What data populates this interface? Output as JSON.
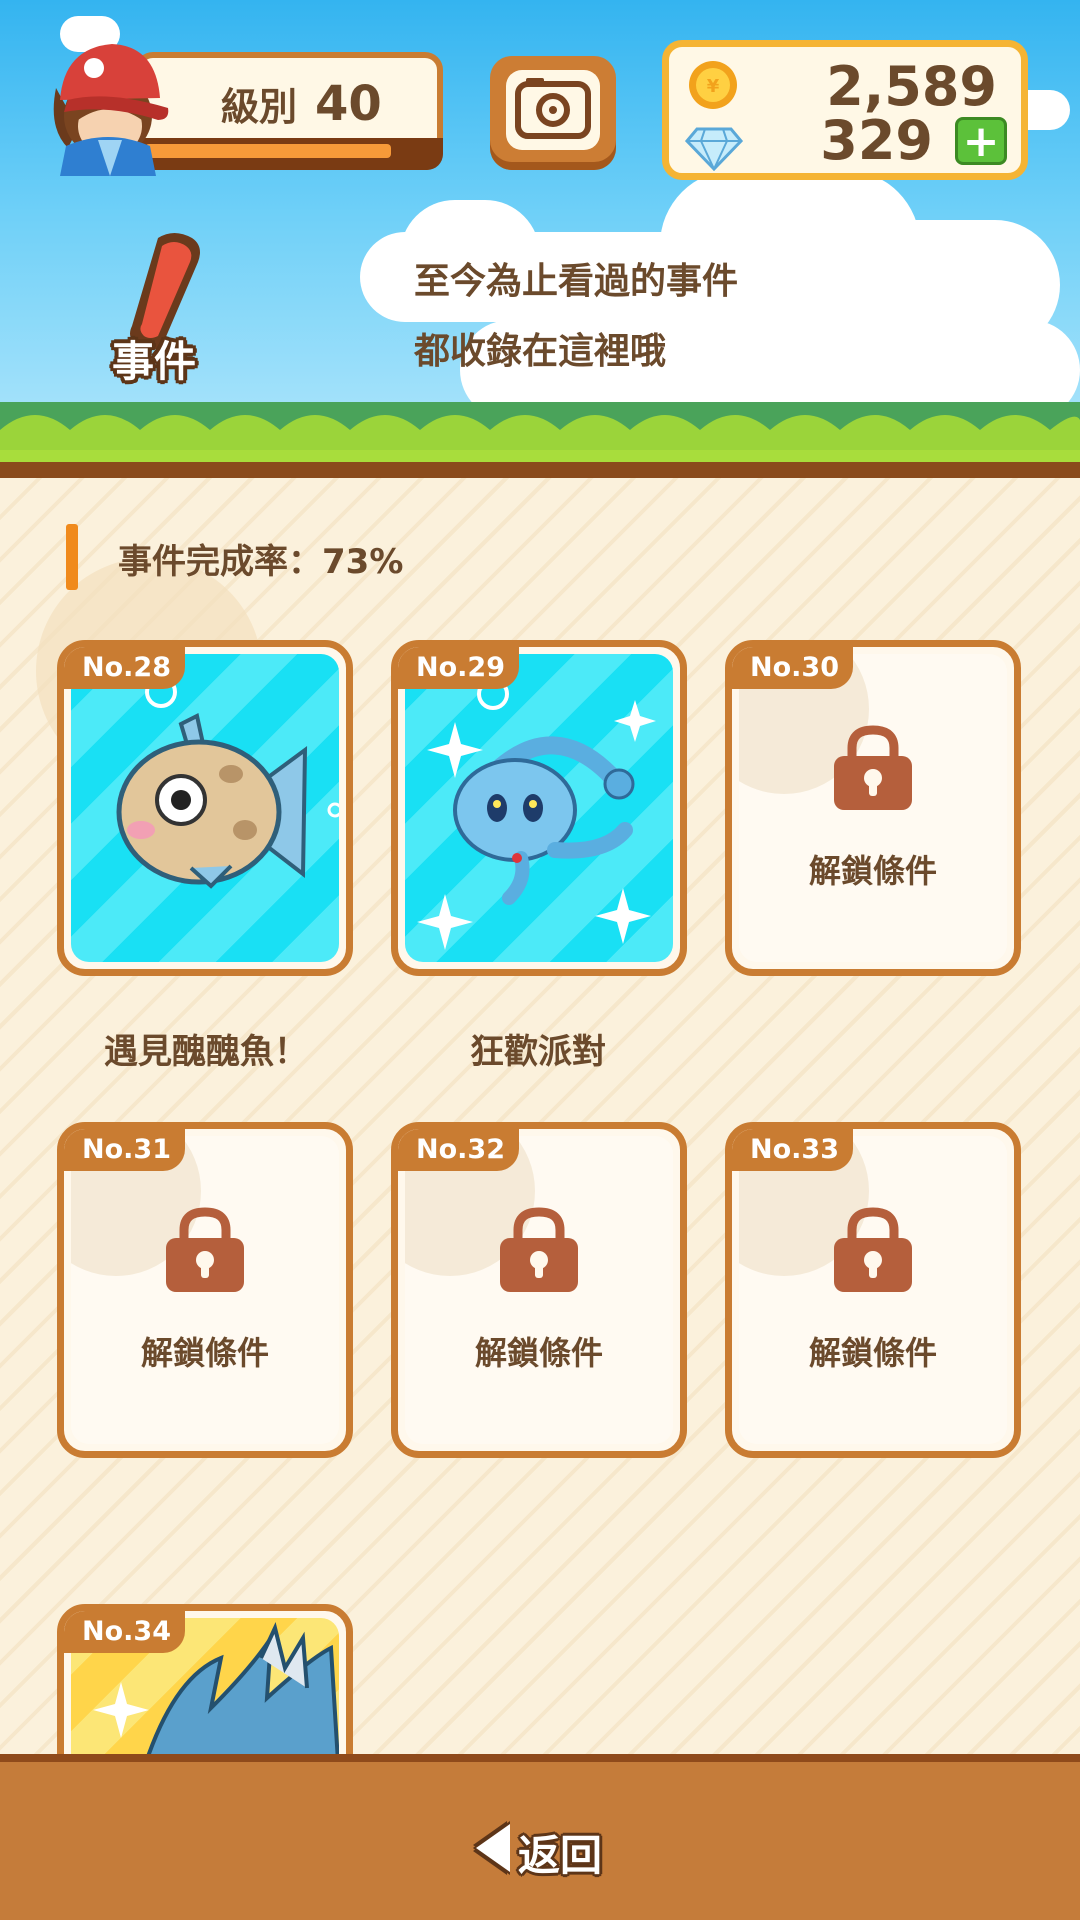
{
  "header": {
    "level_label": "級別",
    "level_value": "40",
    "xp_progress": 0.88,
    "coins": "2,589",
    "gems": "329",
    "add_gems_label": "+"
  },
  "banner": {
    "tag_label": "事件",
    "intro_line_1": "至今為止看過的事件",
    "intro_line_2": "都收錄在這裡哦"
  },
  "content": {
    "completion_text": "事件完成率：73%",
    "events": [
      {
        "number": "No.28",
        "caption": "遇見醜醜魚！",
        "locked": false,
        "art": "feebas-icon"
      },
      {
        "number": "No.29",
        "caption": "狂歡派對",
        "locked": false,
        "art": "manaphy-icon"
      },
      {
        "number": "No.30",
        "unlock_label": "解鎖條件",
        "locked": true
      },
      {
        "number": "No.31",
        "unlock_label": "解鎖條件",
        "locked": true
      },
      {
        "number": "No.32",
        "unlock_label": "解鎖條件",
        "locked": true
      },
      {
        "number": "No.33",
        "unlock_label": "解鎖條件",
        "locked": true
      },
      {
        "number": "No.34",
        "locked": false,
        "art": "gyarados-icon"
      }
    ]
  },
  "footer": {
    "back_label": "返回"
  },
  "colors": {
    "brown_border": "#c97c32",
    "text_brown": "#6b4a2c",
    "accent_orange": "#f08a1c",
    "aqua": "#19e0f4",
    "plus_green": "#5cc13a"
  }
}
